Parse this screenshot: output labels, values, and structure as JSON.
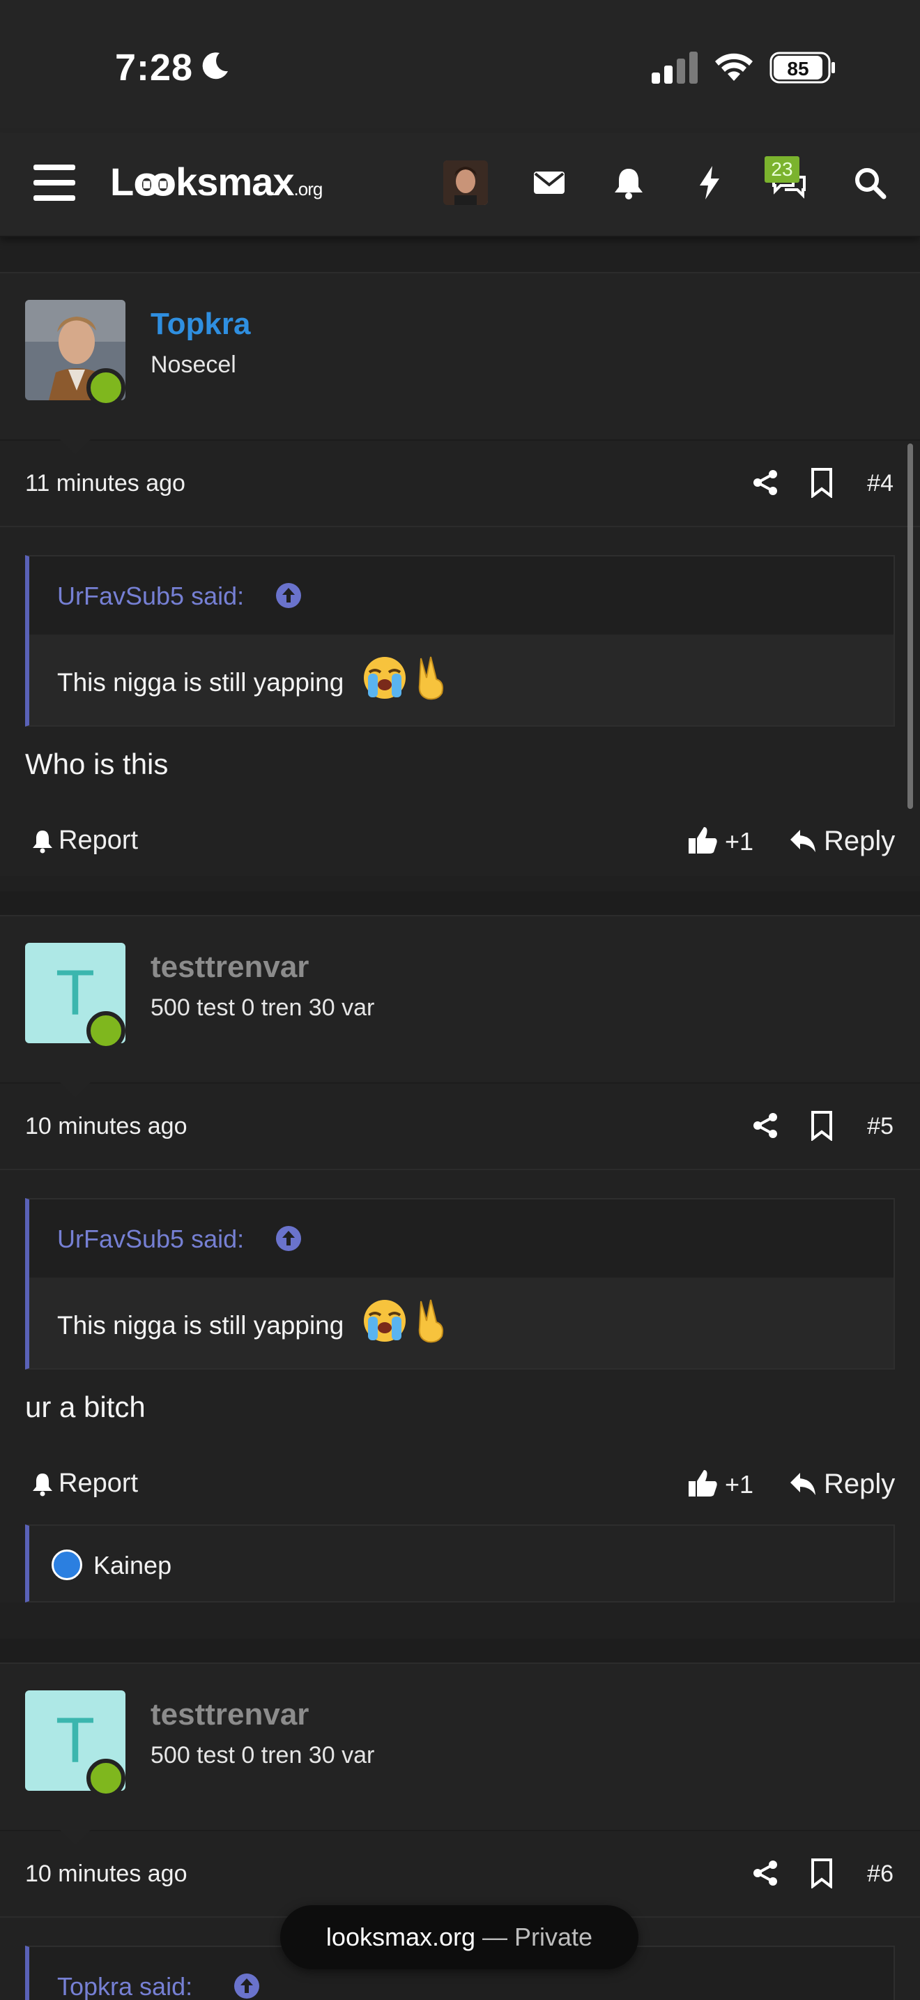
{
  "status_bar": {
    "time": "7:28",
    "battery": "85"
  },
  "navbar": {
    "logo_main": "Lꙭksmax",
    "logo_suffix": ".org",
    "badge_count": "23"
  },
  "posts": [
    {
      "username": "Topkra",
      "user_title": "Nosecel",
      "time": "11 minutes ago",
      "post_number": "#4",
      "quote_author": "UrFavSub5 said:",
      "quote_text": "This nigga is still yapping",
      "message": "Who is this",
      "report_label": "Report",
      "like_count": "+1",
      "reply_label": "Reply"
    },
    {
      "username": "testtrenvar",
      "avatar_letter": "T",
      "user_title": "500 test 0 tren 30 var",
      "time": "10 minutes ago",
      "post_number": "#5",
      "quote_author": "UrFavSub5 said:",
      "quote_text": "This nigga is still yapping",
      "message": "ur a bitch",
      "report_label": "Report",
      "like_count": "+1",
      "reply_label": "Reply",
      "reaction_user": "Kainep"
    },
    {
      "username": "testtrenvar",
      "avatar_letter": "T",
      "user_title": "500 test 0 tren 30 var",
      "time": "10 minutes ago",
      "post_number": "#6",
      "quote_author": "Topkra said:"
    }
  ],
  "toast": {
    "site": "looksmax.org",
    "separator": " — ",
    "mode": "Private"
  }
}
